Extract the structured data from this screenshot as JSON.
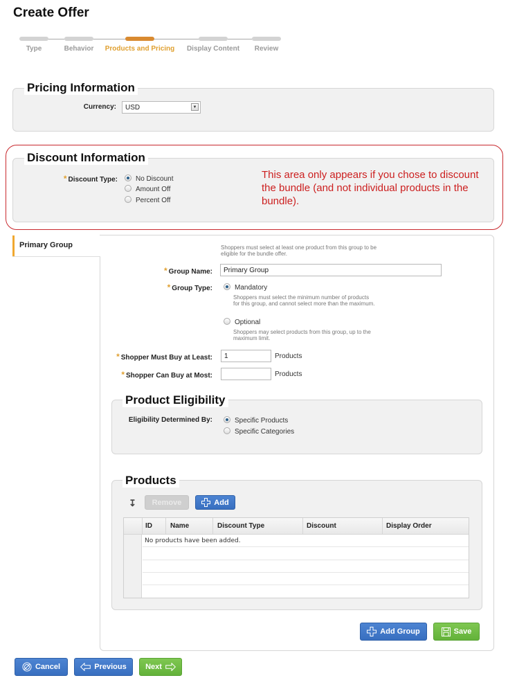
{
  "page": {
    "title": "Create Offer"
  },
  "wizard": {
    "steps": [
      {
        "label": "Type",
        "state": "inactive"
      },
      {
        "label": "Behavior",
        "state": "inactive"
      },
      {
        "label": "Products and Pricing",
        "state": "active"
      },
      {
        "label": "Display Content",
        "state": "inactive"
      },
      {
        "label": "Review",
        "state": "inactive"
      }
    ]
  },
  "pricing": {
    "legend": "Pricing Information",
    "currency_label": "Currency:",
    "currency_value": "USD"
  },
  "discount": {
    "legend": "Discount Information",
    "type_label": "Discount Type:",
    "options": [
      {
        "label": "No Discount",
        "selected": true
      },
      {
        "label": "Amount Off",
        "selected": false
      },
      {
        "label": "Percent Off",
        "selected": false
      }
    ],
    "annotation": "This area only appears if you chose to discount the bundle (and not individual products in the bundle).",
    "annotation_color": "#cc1f1f"
  },
  "group_tab": {
    "label": "Primary Group"
  },
  "group": {
    "intro": "Shoppers must select at least one product from this group to be eligible for the bundle offer.",
    "name_label": "Group Name:",
    "name_value": "Primary Group",
    "type_label": "Group Type:",
    "type_options": [
      {
        "label": "Mandatory",
        "selected": true,
        "hint": "Shoppers must select the minimum number of products for this group, and cannot select more than the maximum."
      },
      {
        "label": "Optional",
        "selected": false,
        "hint": "Shoppers may select products from this group, up to the maximum limit."
      }
    ],
    "min_label": "Shopper Must Buy at Least:",
    "min_value": "1",
    "min_unit": "Products",
    "max_label": "Shopper Can Buy at Most:",
    "max_value": "",
    "max_unit": "Products"
  },
  "eligibility": {
    "legend": "Product Eligibility",
    "label": "Eligibility Determined By:",
    "options": [
      {
        "label": "Specific Products",
        "selected": true
      },
      {
        "label": "Specific Categories",
        "selected": false
      }
    ]
  },
  "products": {
    "legend": "Products",
    "remove_label": "Remove",
    "add_label": "Add",
    "columns": [
      "ID",
      "Name",
      "Discount Type",
      "Discount",
      "Display Order"
    ],
    "empty_message": "No products have been added."
  },
  "actions": {
    "add_group_label": "Add Group",
    "save_label": "Save",
    "cancel_label": "Cancel",
    "previous_label": "Previous",
    "next_label": "Next"
  },
  "colors": {
    "accent_orange": "#e0a030",
    "button_blue": "#3f76c7",
    "button_green": "#6cb944"
  }
}
